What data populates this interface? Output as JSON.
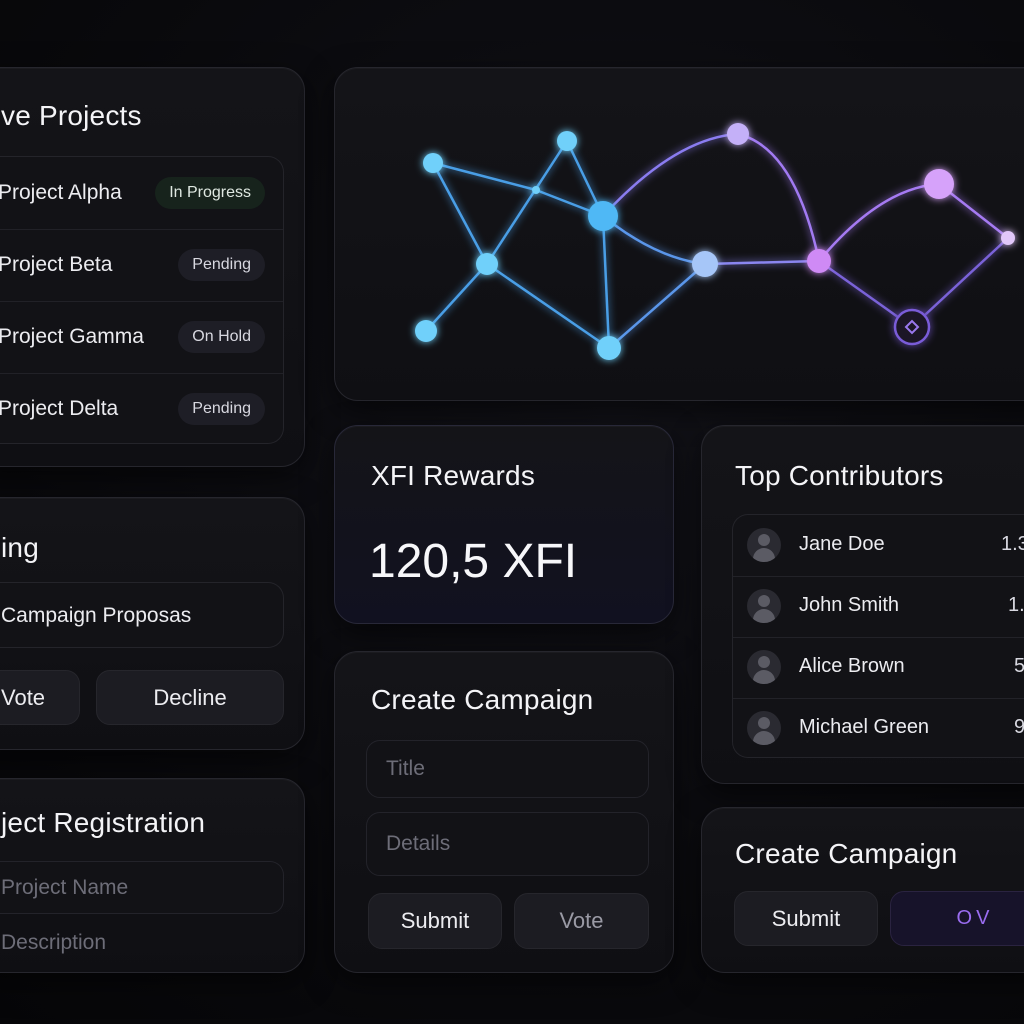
{
  "projects": {
    "title": "ve Projects",
    "items": [
      {
        "name": "Project Alpha",
        "status": "In Progress"
      },
      {
        "name": "Project Beta",
        "status": "Pending"
      },
      {
        "name": "Project Gamma",
        "status": "On Hold"
      },
      {
        "name": "Project Delta",
        "status": "Pending"
      }
    ]
  },
  "voting": {
    "title": "ing",
    "proposal": "Campaign Proposas",
    "vote_label": "Vote",
    "decline_label": "Decline"
  },
  "registration": {
    "title": "ject Registration",
    "name_placeholder": "Project Name",
    "description_placeholder": "Description"
  },
  "rewards": {
    "title": "XFI Rewards",
    "amount": "120,5 XFI"
  },
  "create_campaign": {
    "title": "Create Campaign",
    "title_placeholder": "Title",
    "details_placeholder": "Details",
    "submit_label": "Submit",
    "vote_label": "Vote"
  },
  "contributors": {
    "title": "Top Contributors",
    "items": [
      {
        "name": "Jane Doe",
        "value": "1.3"
      },
      {
        "name": "John Smith",
        "value": "1."
      },
      {
        "name": "Alice Brown",
        "value": "5"
      },
      {
        "name": "Michael Green",
        "value": "9"
      }
    ]
  },
  "create_campaign_2": {
    "title": "Create Campaign",
    "submit_label": "Submit",
    "secondary_label": "OV"
  },
  "colors": {
    "accent_blue": "#5fc4f5",
    "accent_purple": "#b784f5",
    "background": "#09090c"
  }
}
